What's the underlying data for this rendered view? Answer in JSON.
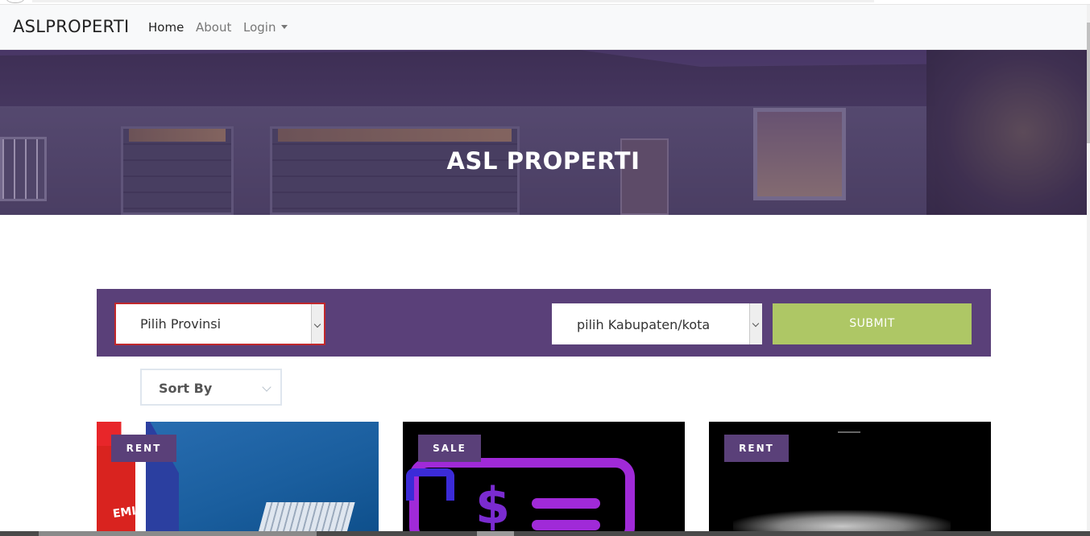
{
  "navbar": {
    "brand": "ASLPROPERTI",
    "links": [
      {
        "label": "Home"
      },
      {
        "label": "About"
      },
      {
        "label": "Login"
      }
    ]
  },
  "hero": {
    "title": "ASL PROPERTI"
  },
  "search": {
    "province": {
      "value": "Pilih Provinsi"
    },
    "regency": {
      "value": "pilih Kabupaten/kota"
    },
    "submit_label": "SUBMIT"
  },
  "sort": {
    "label": "Sort By"
  },
  "cards": [
    {
      "badge": "RENT",
      "image_text": "EMI"
    },
    {
      "badge": "SALE",
      "image_text": "$"
    },
    {
      "badge": "RENT"
    }
  ],
  "colors": {
    "primary_purple": "#5a4079",
    "submit_green": "#aec765",
    "navbar_bg": "#f8f9fa",
    "error_border": "#c0282c"
  },
  "icons": {
    "login_dropdown": "caret-down-icon",
    "select_arrow": "chevron-down-icon"
  }
}
